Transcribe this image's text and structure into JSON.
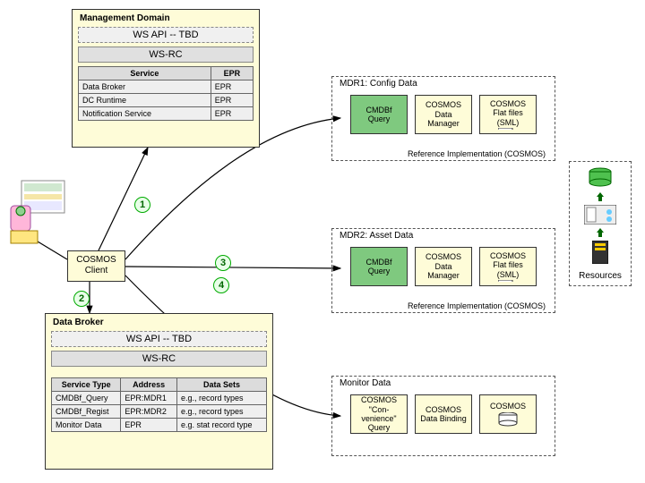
{
  "managementDomain": {
    "title": "Management Domain",
    "apiStrip": "WS API -- TBD",
    "wsrcStrip": "WS-RC",
    "table": {
      "headers": [
        "Service",
        "EPR"
      ],
      "rows": [
        [
          "Data Broker",
          "EPR"
        ],
        [
          "DC Runtime",
          "EPR"
        ],
        [
          "Notification Service",
          "EPR"
        ]
      ]
    }
  },
  "cosmosClient": {
    "line1": "COSMOS",
    "line2": "Client"
  },
  "dataBroker": {
    "title": "Data Broker",
    "apiStrip": "WS API -- TBD",
    "wsrcStrip": "WS-RC",
    "table": {
      "headers": [
        "Service Type",
        "Address",
        "Data Sets"
      ],
      "rows": [
        [
          "CMDBf_Query",
          "EPR:MDR1",
          "e.g., record types"
        ],
        [
          "CMDBf_Regist",
          "EPR:MDR2",
          "e.g., record types"
        ],
        [
          "Monitor Data",
          "EPR",
          "e.g. stat record type"
        ]
      ]
    }
  },
  "mdr1": {
    "title": "MDR1: Config Data",
    "ref": "Reference Implementation (COSMOS)",
    "boxes": [
      "CMDBf Query",
      "COSMOS Data Manager",
      "COSMOS Flat files (SML)"
    ]
  },
  "mdr2": {
    "title": "MDR2: Asset Data",
    "ref": "Reference Implementation (COSMOS)",
    "boxes": [
      "CMDBf Query",
      "COSMOS Data Manager",
      "COSMOS Flat files (SML)"
    ]
  },
  "monitor": {
    "title": "Monitor Data",
    "boxes": [
      "COSMOS \"Con-venience\" Query",
      "COSMOS Data Binding",
      "COSMOS"
    ]
  },
  "resourcesLabel": "Resources",
  "steps": {
    "s1": "1",
    "s2": "2",
    "s3": "3",
    "s4": "4"
  }
}
